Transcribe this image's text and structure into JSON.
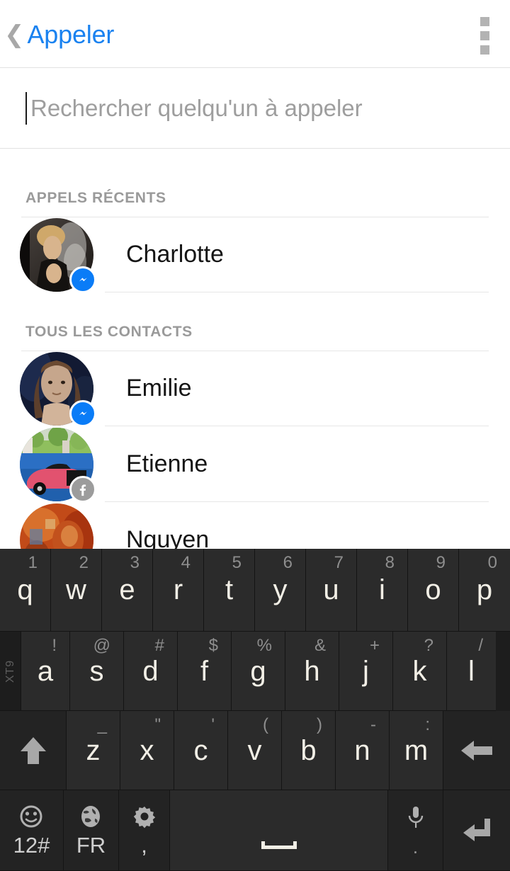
{
  "header": {
    "back_icon": "chevron-left-icon",
    "title": "Appeler",
    "overflow_icon": "overflow-menu-icon",
    "title_color": "#1a82f0"
  },
  "search": {
    "placeholder": "Rechercher quelqu'un à appeler",
    "value": ""
  },
  "sections": [
    {
      "label": "APPELS RÉCENTS",
      "contacts": [
        {
          "name": "Charlotte",
          "badge": "messenger-badge-icon",
          "avatar": "charlotte-avatar"
        }
      ]
    },
    {
      "label": "TOUS LES CONTACTS",
      "contacts": [
        {
          "name": "Emilie",
          "badge": "messenger-badge-icon",
          "avatar": "emilie-avatar"
        },
        {
          "name": "Etienne",
          "badge": "facebook-badge-icon",
          "avatar": "etienne-avatar"
        },
        {
          "name": "Nguyen",
          "badge": "none",
          "avatar": "nguyen-avatar"
        }
      ]
    }
  ],
  "keyboard": {
    "xt9_label": "XT9",
    "row1": [
      {
        "main": "q",
        "alt": "1"
      },
      {
        "main": "w",
        "alt": "2"
      },
      {
        "main": "e",
        "alt": "3"
      },
      {
        "main": "r",
        "alt": "4"
      },
      {
        "main": "t",
        "alt": "5"
      },
      {
        "main": "y",
        "alt": "6"
      },
      {
        "main": "u",
        "alt": "7"
      },
      {
        "main": "i",
        "alt": "8"
      },
      {
        "main": "o",
        "alt": "9"
      },
      {
        "main": "p",
        "alt": "0"
      }
    ],
    "row2": [
      {
        "main": "a",
        "alt": "!"
      },
      {
        "main": "s",
        "alt": "@"
      },
      {
        "main": "d",
        "alt": "#"
      },
      {
        "main": "f",
        "alt": "$"
      },
      {
        "main": "g",
        "alt": "%"
      },
      {
        "main": "h",
        "alt": "&"
      },
      {
        "main": "j",
        "alt": "+"
      },
      {
        "main": "k",
        "alt": "?"
      },
      {
        "main": "l",
        "alt": "/"
      }
    ],
    "row3": {
      "shift_icon": "shift-arrow-icon",
      "keys": [
        {
          "main": "z",
          "alt": "_"
        },
        {
          "main": "x",
          "alt": "\""
        },
        {
          "main": "c",
          "alt": "'"
        },
        {
          "main": "v",
          "alt": "("
        },
        {
          "main": "b",
          "alt": ")"
        },
        {
          "main": "n",
          "alt": "-"
        },
        {
          "main": "m",
          "alt": ":"
        }
      ],
      "backspace_icon": "backspace-arrow-icon"
    },
    "row4": {
      "emoji_icon": "smiley-icon",
      "symbols_label": "12#",
      "globe_icon": "globe-icon",
      "language_label": "FR",
      "settings_icon": "gear-icon",
      "comma_label": ",",
      "space_icon": "spacebar-marker",
      "mic_icon": "microphone-icon",
      "period_label": ".",
      "enter_icon": "enter-arrow-icon"
    }
  },
  "colors": {
    "accent_blue": "#1a82f0",
    "messenger_blue": "#0a7cf7",
    "facebook_gray": "#9c9c9c",
    "keyboard_bg": "#1d1d1d",
    "key_bg": "#2b2b2b"
  }
}
